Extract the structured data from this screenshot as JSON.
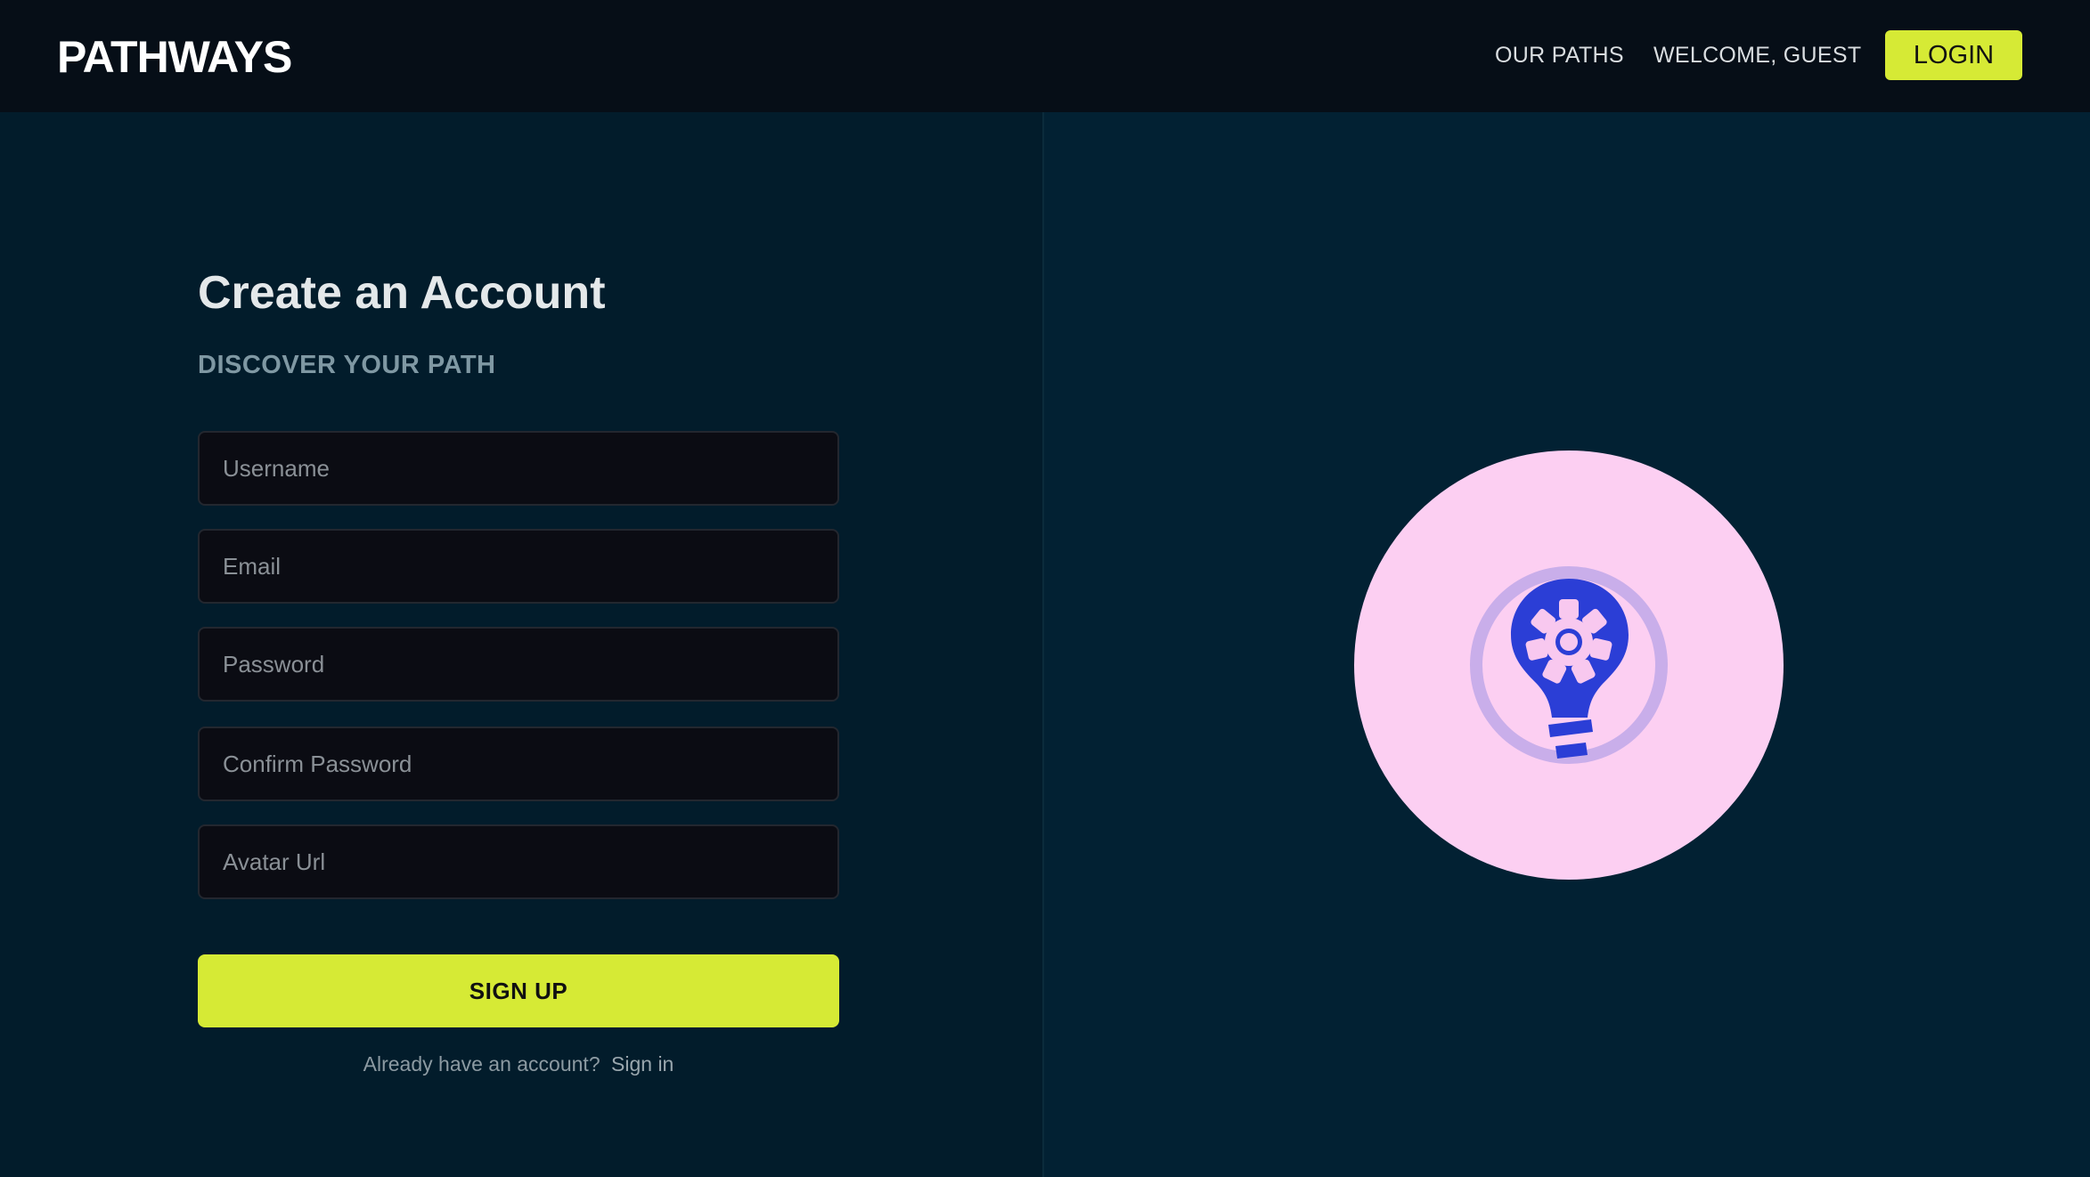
{
  "header": {
    "logo_text": "PATHWAYS",
    "nav": {
      "our_paths": "OUR PATHS",
      "welcome": "WELCOME, GUEST"
    },
    "login_label": "LOGIN"
  },
  "form": {
    "title": "Create an Account",
    "subtitle": "DISCOVER YOUR PATH",
    "fields": {
      "username": {
        "placeholder": "Username",
        "value": ""
      },
      "email": {
        "placeholder": "Email",
        "value": ""
      },
      "password": {
        "placeholder": "Password",
        "value": ""
      },
      "confirm_password": {
        "placeholder": "Confirm Password",
        "value": ""
      },
      "avatar_url": {
        "placeholder": "Avatar Url",
        "value": ""
      }
    },
    "submit_label": "SIGN UP",
    "signin_prompt": "Already have an account?",
    "signin_link": "Sign in"
  },
  "illustration": {
    "icon": "lightbulb-gear-icon"
  },
  "colors": {
    "accent": "#d6ea35",
    "header_bg": "#060e17",
    "left_bg": "#021c2b",
    "right_bg": "#022133",
    "circle_bg": "#fccff2",
    "ring": "#c9aeea",
    "bulb": "#2b3ed6"
  }
}
